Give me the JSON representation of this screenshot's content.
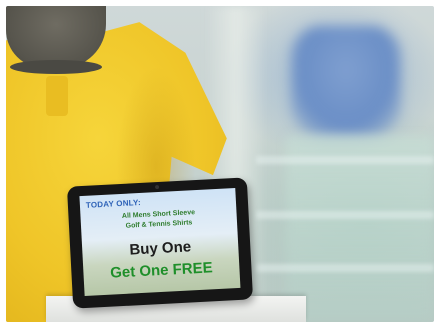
{
  "photo": {
    "colors": {
      "shirt_yellow": "#efc528",
      "cap_grey": "#56544c",
      "tablet_frame": "#161616",
      "headline_blue": "#2f63b8",
      "detail_green": "#2f7d2e",
      "free_green": "#1f8f2a"
    }
  },
  "tablet_sign": {
    "headline": "TODAY ONLY:",
    "line1": "All Mens Short Sleeve",
    "line2": "Golf & Tennis Shirts",
    "offer_top": "Buy One",
    "offer_bottom": "Get One FREE"
  }
}
